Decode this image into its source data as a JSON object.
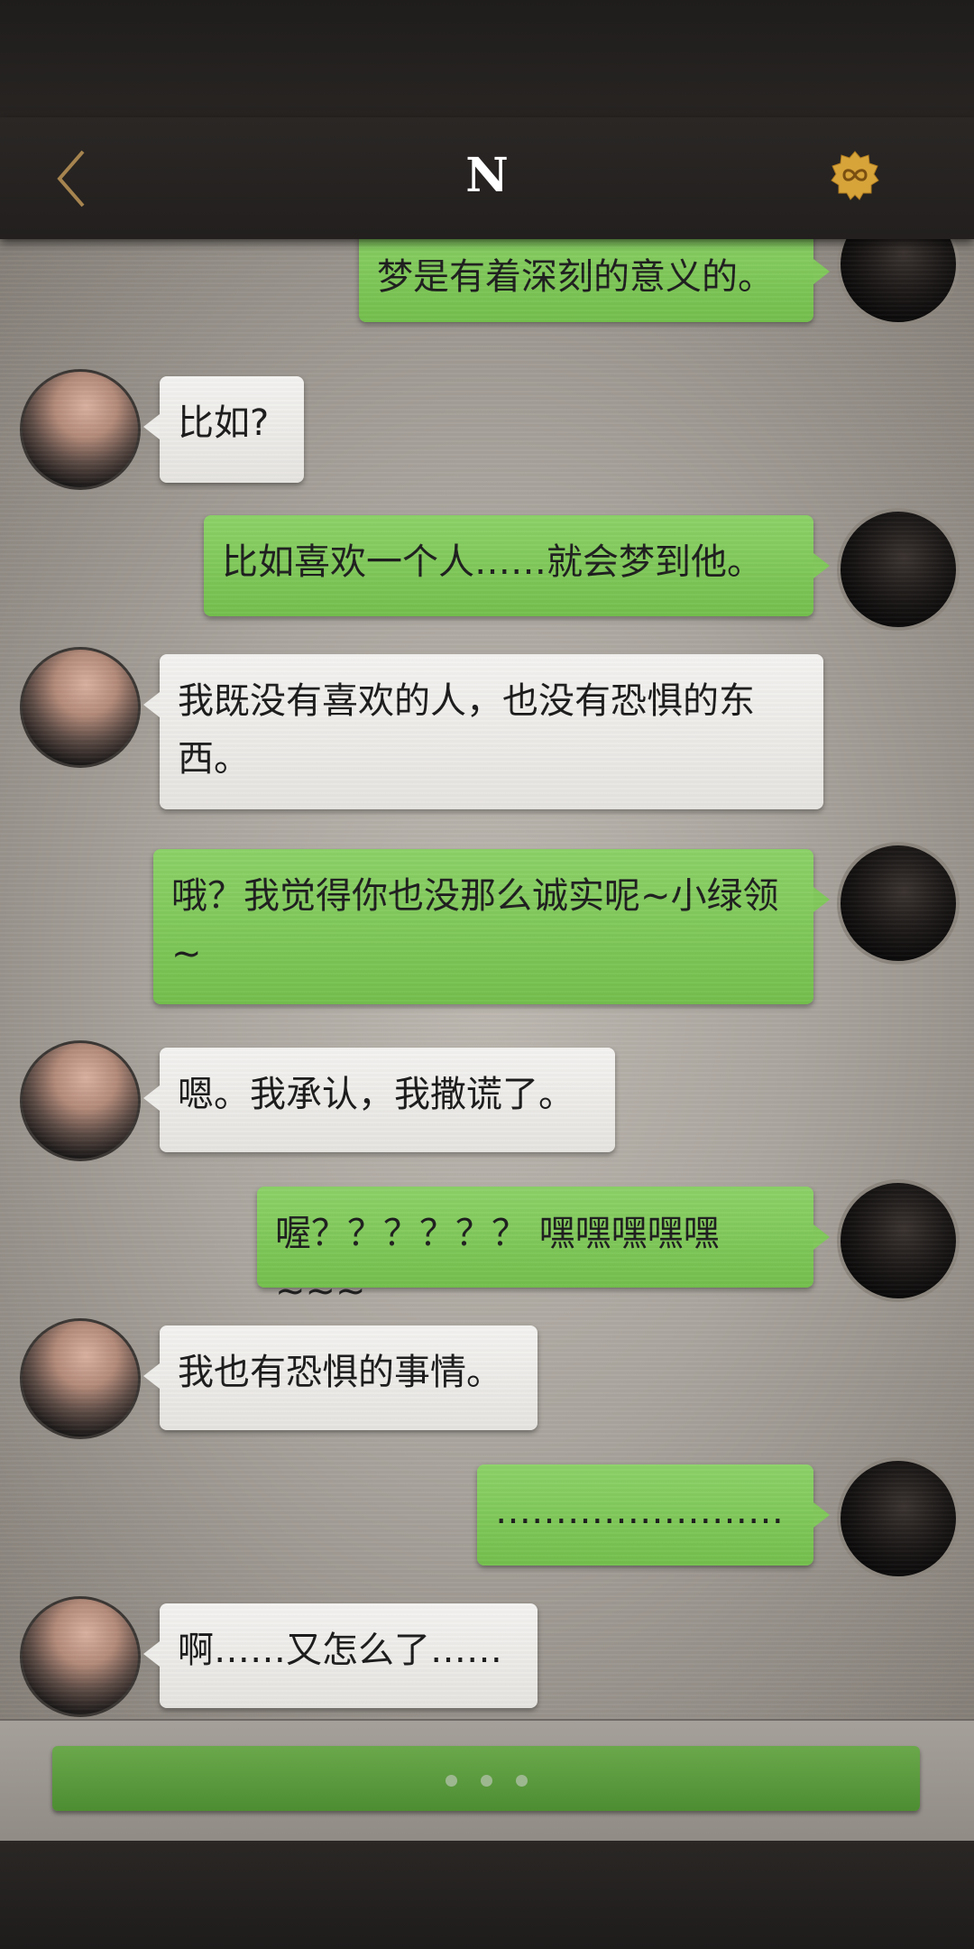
{
  "header": {
    "title": "N",
    "back_icon": "chevron-left-icon",
    "badge_icon": "infinity-badge-icon"
  },
  "messages": [
    {
      "sender": "self",
      "text": "梦是有着深刻的意义的。"
    },
    {
      "sender": "other",
      "text": "比如?"
    },
    {
      "sender": "self",
      "text": "比如喜欢一个人……就会梦到他。"
    },
    {
      "sender": "other",
      "text": "我既没有喜欢的人，也没有恐惧的东西。"
    },
    {
      "sender": "self",
      "text": "哦？我觉得你也没那么诚实呢~小绿领~"
    },
    {
      "sender": "other",
      "text": "嗯。我承认，我撒谎了。"
    },
    {
      "sender": "self",
      "text": "喔？？？？？？ 嘿嘿嘿嘿嘿~~~"
    },
    {
      "sender": "other",
      "text": "我也有恐惧的事情。"
    },
    {
      "sender": "self",
      "text": "……………………"
    },
    {
      "sender": "other",
      "text": "啊……又怎么了……"
    }
  ],
  "input": {
    "reply_button_icon": "ellipsis-dots-icon"
  },
  "colors": {
    "self_bubble": "#7cc655",
    "other_bubble": "#eeedea",
    "header": "#262321",
    "accent_badge": "#d9a53b"
  }
}
